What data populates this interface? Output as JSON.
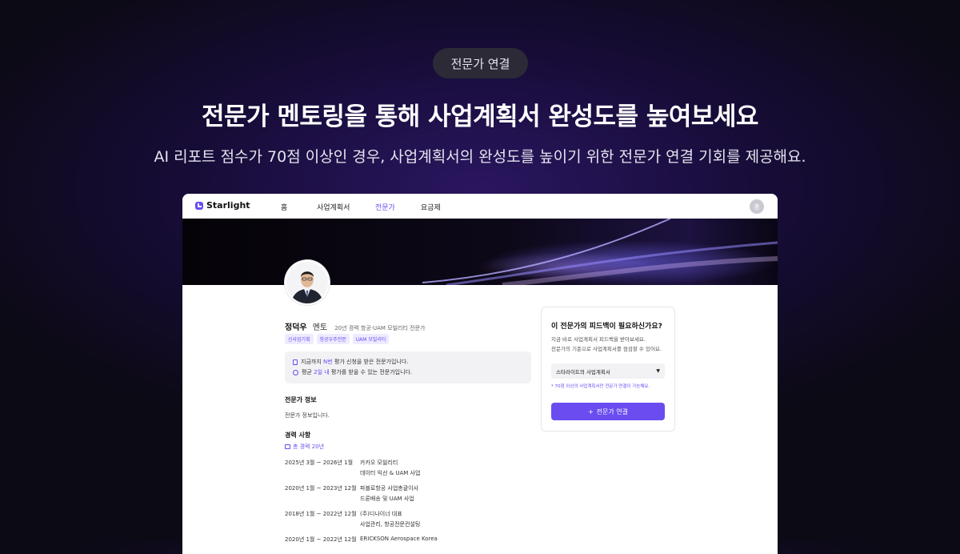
{
  "badge": "전문가 연결",
  "hero": {
    "title": "전문가 멘토링을 통해 사업계획서 완성도를 높여보세요",
    "subtitle": "AI 리포트 점수가 70점 이상인 경우, 사업계획서의 완성도를 높이기 위한 전문가 연결 기회를 제공해요."
  },
  "app": {
    "brand": "Starlight",
    "nav": [
      "홈",
      "사업계획서",
      "전문가",
      "요금제"
    ],
    "active_nav": "전문가",
    "user_initial": "홍"
  },
  "mentor": {
    "name": "정덕우",
    "role": "멘토",
    "headline": "20년 경력 항공·UAM 모빌리티 전문가",
    "tags": [
      "신사업기획",
      "항공우주전문",
      "UAM 모빌리티"
    ],
    "stat1": {
      "pre": "지금까지 ",
      "value": "N번",
      "post": " 평가 신청을 받은 전문가입니다."
    },
    "stat2": {
      "pre": "평균 ",
      "value": "2일 내",
      "post": " 평가를 받을 수 있는 전문가입니다."
    },
    "info_title": "전문가 정보",
    "info_text": "전문가 정보입니다.",
    "career_title": "경력 사항",
    "career_total": "총 경력 20년",
    "careers": [
      {
        "period": "2025년 3월 ~ 2026년 1월",
        "company": "카카오 모빌리티",
        "desc": "데이터 익선 & UAM 사업"
      },
      {
        "period": "2020년 1월 ~ 2023년 12월",
        "company": "파블로항공 사업총괄이사",
        "desc": "드론배송 및 UAM 사업"
      },
      {
        "period": "2018년 1월 ~ 2022년 12월",
        "company": "(주)디나이너 대표",
        "desc": "사업관리, 항공전문컨설팅"
      },
      {
        "period": "2020년 1월 ~ 2022년 12월",
        "company": "ERICKSON Aerospace Korea",
        "desc": ""
      }
    ]
  },
  "request_card": {
    "title": "이 전문가의 피드백이 필요하신가요?",
    "desc1": "지금 바로 사업계획서 피드백을 받아보세요.",
    "desc2": "전문가의 기준으로 사업계획서를 점검할 수 있어요.",
    "select_value": "스타라이트의 사업계획서",
    "note": "* 70점 이상의 사업계획서만 전문가 연결이 가능해요.",
    "cta": "전문가 연결"
  },
  "colors": {
    "accent": "#6a4cf0",
    "background": "#0c0a14",
    "panel": "#f2f2f5"
  }
}
